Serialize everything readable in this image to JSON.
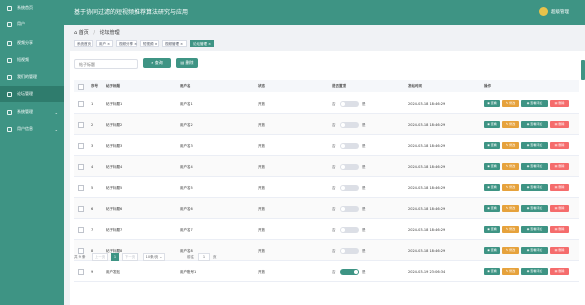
{
  "header": {
    "title": "基于协同过滤的短视频推荐算法研究与应用",
    "user": "超级管理"
  },
  "sidebar": {
    "items": [
      {
        "label": "系统首页",
        "active": false,
        "chevron": ""
      },
      {
        "label": "用户",
        "active": false,
        "chevron": ""
      },
      {
        "label": "视频分享",
        "active": false,
        "chevron": ""
      },
      {
        "label": "短视频",
        "active": false,
        "chevron": ""
      },
      {
        "label": "我们的管理",
        "active": false,
        "chevron": ""
      },
      {
        "label": "论坛管理",
        "active": true,
        "chevron": ""
      },
      {
        "label": "系统管理",
        "active": false,
        "chevron": "⌄"
      },
      {
        "label": "用户信息",
        "active": false,
        "chevron": "⌄"
      }
    ]
  },
  "breadcrumb": {
    "home": "首页",
    "sep": "/",
    "current": "论坛管理"
  },
  "tags": [
    {
      "label": "系统首页",
      "active": false
    },
    {
      "label": "用户 ×",
      "active": false
    },
    {
      "label": "视频分享 ×",
      "active": false
    },
    {
      "label": "短视频 ×",
      "active": false
    },
    {
      "label": "视频管理 ×",
      "active": false
    },
    {
      "label": "论坛管理 ×",
      "active": true
    }
  ],
  "search": {
    "placeholder": "帖子标题",
    "button": "查询",
    "delete": "删除"
  },
  "table": {
    "headers": [
      "序号",
      "帖子标题",
      "用户名",
      "状态",
      "是否置顶",
      "发帖时间",
      "操作"
    ],
    "rows": [
      {
        "index": "1",
        "title": "帖子标题1",
        "user": "用户名1",
        "status": "开放",
        "top": false,
        "time": "2024-03-18 18:46:29"
      },
      {
        "index": "2",
        "title": "帖子标题2",
        "user": "用户名2",
        "status": "开放",
        "top": false,
        "time": "2024-03-18 18:46:29"
      },
      {
        "index": "3",
        "title": "帖子标题3",
        "user": "用户名3",
        "status": "开放",
        "top": false,
        "time": "2024-03-18 18:46:29"
      },
      {
        "index": "4",
        "title": "帖子标题4",
        "user": "用户名4",
        "status": "开放",
        "top": false,
        "time": "2024-03-18 18:46:29"
      },
      {
        "index": "5",
        "title": "帖子标题5",
        "user": "用户名5",
        "status": "开放",
        "top": false,
        "time": "2024-03-18 18:46:29"
      },
      {
        "index": "6",
        "title": "帖子标题6",
        "user": "用户名6",
        "status": "开放",
        "top": false,
        "time": "2024-03-18 18:46:29"
      },
      {
        "index": "7",
        "title": "帖子标题7",
        "user": "用户名7",
        "status": "开放",
        "top": false,
        "time": "2024-03-18 18:46:29"
      },
      {
        "index": "8",
        "title": "帖子标题8",
        "user": "用户名8",
        "status": "开放",
        "top": false,
        "time": "2024-03-18 18:46:29"
      },
      {
        "index": "9",
        "title": "用户发贴",
        "user": "用户账号1",
        "status": "开放",
        "top": true,
        "time": "2024-03-19 23:06:34"
      }
    ],
    "switch_left": "否",
    "switch_right": "是",
    "actions": {
      "view": "查看",
      "edit": "修改",
      "comment": "查看评论",
      "delete": "删除"
    }
  },
  "pagination": {
    "total": "共 9 条",
    "prev": "上一页",
    "page": "1",
    "next": "下一页",
    "size": "10条/页",
    "goto": "前往",
    "goto_value": "1",
    "unit": "页"
  },
  "colors": {
    "primary": "#3e9484",
    "warning": "#e6a23c",
    "danger": "#f56c6c"
  }
}
